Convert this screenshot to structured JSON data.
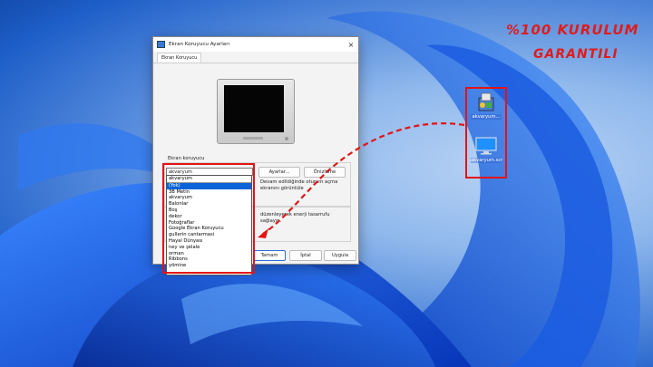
{
  "promo": {
    "line1": "%100 KURULUM",
    "line2": "GARANTILI"
  },
  "dialog": {
    "title": "Ekran Koruyucu Ayarları",
    "close_glyph": "×",
    "tab": "Ekran Koruyucu",
    "group_label": "Ekran koruyucu",
    "combo_value": "akvaryum",
    "settings_button": "Ayarlar...",
    "preview_button": "Önizleme",
    "resume_text_line1": "Devam edildiğinde oturum açma",
    "resume_text_line2": "ekranını görüntüle",
    "power_text_line1": "düzenleyerek enerji tasarrufu",
    "power_text_line2": "sağlayın.",
    "ok_button": "Tamam",
    "cancel_button": "İptal",
    "apply_button": "Uygula"
  },
  "dropdown": {
    "header": "akvaryum",
    "options": [
      "(Yok)",
      "3B Metin",
      "akvaryum",
      "Balonlar",
      "Boş",
      "dekor",
      "Fotoğraflar",
      "Google Ekran Koruyucu",
      "gullerin cantarmasi",
      "Hayal Dünyası",
      "ney ve şelale",
      "orman",
      "Ribbons",
      "yömine"
    ],
    "selected_index": 0
  },
  "desktop_icons": [
    {
      "label": "akvaryum...",
      "icon": "installer-icon"
    },
    {
      "label": "akvaryum.scr",
      "icon": "screensaver-icon"
    }
  ],
  "colors": {
    "accent_red": "#e41414",
    "selection_blue": "#0a64d8"
  }
}
